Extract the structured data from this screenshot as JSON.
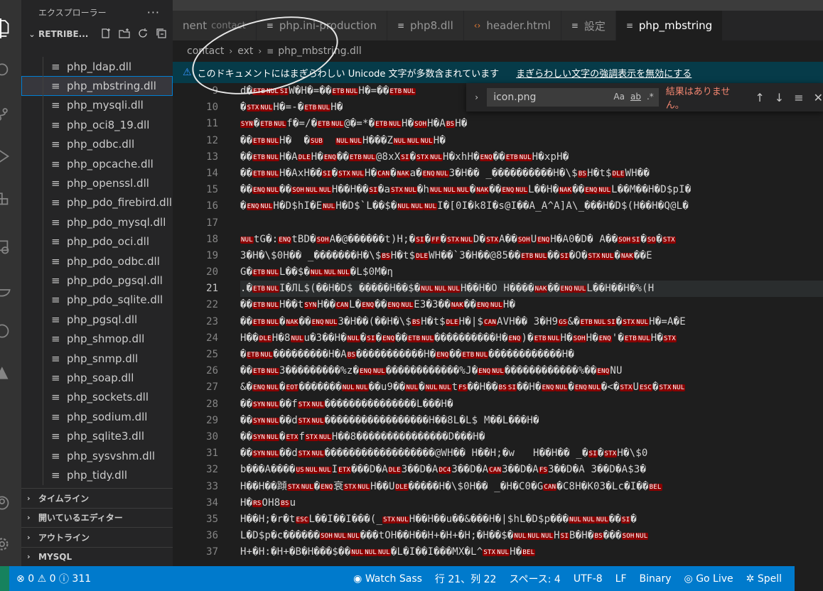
{
  "explorer": {
    "title": "エクスプローラー",
    "more": "···",
    "folder": "RETRIBE...",
    "files": [
      "php_ldap.dll",
      "php_mbstring.dll",
      "php_mysqli.dll",
      "php_oci8_19.dll",
      "php_odbc.dll",
      "php_opcache.dll",
      "php_openssl.dll",
      "php_pdo_firebird.dll",
      "php_pdo_mysql.dll",
      "php_pdo_oci.dll",
      "php_pdo_odbc.dll",
      "php_pdo_pgsql.dll",
      "php_pdo_sqlite.dll",
      "php_pgsql.dll",
      "php_shmop.dll",
      "php_snmp.dll",
      "php_soap.dll",
      "php_sockets.dll",
      "php_sodium.dll",
      "php_sqlite3.dll",
      "php_sysvshm.dll",
      "php_tidy.dll"
    ],
    "selected_index": 1,
    "panels": [
      "タイムライン",
      "開いているエディター",
      "アウトライン",
      "MYSQL"
    ]
  },
  "tabs": [
    {
      "label": "nent",
      "desc": "contact",
      "icon": "file-icon"
    },
    {
      "label": "php.ini-production",
      "icon": "file-icon"
    },
    {
      "label": "php8.dll",
      "icon": "file-icon"
    },
    {
      "label": "header.html",
      "icon": "html-icon"
    },
    {
      "label": "設定",
      "icon": "file-icon"
    },
    {
      "label": "php_mbstring",
      "icon": "file-icon",
      "active": true
    }
  ],
  "breadcrumb": [
    "contact",
    "ext",
    "php_mbstring.dll"
  ],
  "banner": {
    "message": "このドキュメントにはまぎらわしい Unicode 文字が多数含まれています",
    "link": "まぎらわしい文字の強調表示を無効にする"
  },
  "find": {
    "query": "icon.png",
    "opt_case": "Aa",
    "opt_word": "ab",
    "opt_regex": ".*",
    "result": "結果はありません。"
  },
  "editor": {
    "current_line": 21,
    "lines": [
      {
        "n": 9,
        "text": "d�ETBNULSIW�H�=��ETBNULH�=��ETBNUL"
      },
      {
        "n": 10,
        "text": "�STXNULH�=-�ETBNULH�"
      },
      {
        "n": 11,
        "text": "SYN�ETBNULf�=/�ETBNUL@�=*�ETBNULH�SOHH�ABSH�"
      },
      {
        "n": 12,
        "text": "��ETBNULH�  �SUB  NULNULH���ZNULNULNULH�"
      },
      {
        "n": 13,
        "text": "��ETBNULH�ADLEH�ENQ��ETBNUL@8xXSI�STXNULH�xhH�ENQ��ETBNULH�xpH�"
      },
      {
        "n": 14,
        "text": "��ETBNULH�AxH��SI�STXNULH�CAN�NAKa�ENQNUL3�H�� _����������H�\\$BSH�t$DLEWH��"
      },
      {
        "n": 15,
        "text": "��ENQNUL��SOHNULNULH��H��SI�aSTXNUL�hNULNULNUL�NAK��ENQNULL��H�NAK��ENQNULL��M��H�D$pI�"
      },
      {
        "n": 16,
        "text": "�ENQNULH�D$hI�ENULH�D$`L��$�NULNULNULI�[0I�k8I�s@I��A_A^A]A\\_���H�D$(H��H�Q@L�"
      },
      {
        "n": 17,
        "text": ""
      },
      {
        "n": 18,
        "text": "NULtG�:ENQtBD�SOHA�@������t)H;�SI�FF�STXNULD�STXA��SOHUENQH�A0�D� A��SOHSI�SO�STX"
      },
      {
        "n": 19,
        "text": "3�H�\\$0H�� _�������H�\\$BSH�t$DLEWH��`3�H��@85��ETBNUL��SI�O�STXNUL�NAK��E"
      },
      {
        "n": 20,
        "text": "G�ETBNULL��$�NULNULNUL�L$0M�η"
      },
      {
        "n": 21,
        "text": ".�ETBNULI�ЛL$(��H�D$ �����H��$�NULNULNULH��H�O H����NAK��ENQNULL��H��H�%(H"
      },
      {
        "n": 22,
        "text": "��ETBNULH��tSYNH��CANL�ENQ��ENQNULE3�3��NAK��ENQNULH�"
      },
      {
        "n": 23,
        "text": "��ETBNUL�NAK��ENQNUL3�H��(��H�\\$BSH�t$DLEH�|$CANAVH�� 3�H9GS&�ETBNULSI�STXNULH�=A�E"
      },
      {
        "n": 24,
        "text": "H��DLEH�8NULu�3��H�NUL�SI�ENQ��ETBNUL����������H�ENQ)�ETBNULH�SOHH�ENQ'�ETBNULH�STX"
      },
      {
        "n": 25,
        "text": "�ETBNUL���������H�ABS�����������H�ENQ��ETBNUL������������H�"
      },
      {
        "n": 26,
        "text": "��ETBNUL3���������%z�ENQNUL������������%J�ENQNUL������������%��ENQNU"
      },
      {
        "n": 27,
        "text": "&�ENQNUL�EOT�������NULNUL��u9��NUL�NULNULtFS��H��BSSI��H�ENQNUL�ENQNUL�<�STXUESC�STXNUL"
      },
      {
        "n": 28,
        "text": "��SYNNUL��fSTXNUL���������������L���H�"
      },
      {
        "n": 29,
        "text": "��SYNNUL��dSTXNUL�����������������H��8L�L$ M��L���H�"
      },
      {
        "n": 30,
        "text": "��SYNNUL�ETXfSTXNULH��8���������������D���H�"
      },
      {
        "n": 31,
        "text": "��SYNNUL��dSTXNUL������������������@WH�� H��H;�w   H��H�� _�SI�STXH�\\$0"
      },
      {
        "n": 32,
        "text": "b���A����USNULNULIETX���D�ADLE3��D�ADC43��D�ACAN3��D�AFS3��D�A 3��D�A$3�"
      },
      {
        "n": 33,
        "text": "H��H��蹞STXNUL�ENQ衰STXNULH��UDLE�����H�\\$0H�� _�H�C0�GCAN�C8H�K03�Lc�I��BEL"
      },
      {
        "n": 34,
        "text": "H�RSOH8BSu"
      },
      {
        "n": 35,
        "text": "H��H;�r�tESCL��I��I���(_STXNULH��H��u��&���H�|$hL�D$p���NULNULNUL��SI�"
      },
      {
        "n": 36,
        "text": "L�D$p�c������SOHNULNUL���tOH��H��H+�H+�H;�H��$�NULNULNULHSIB�H�BS���SOHNUL"
      },
      {
        "n": 37,
        "text": "H+�H:�H+�B�H���$��NULNULNUL�L�I��I���MX�L^STXNULH�BEL"
      }
    ]
  },
  "status": {
    "errors": "0",
    "warnings": "0",
    "info": "311",
    "watch_sass": "Watch Sass",
    "position": "行 21、列 22",
    "spaces": "スペース: 4",
    "encoding": "UTF-8",
    "eol": "LF",
    "language": "Binary",
    "go_live": "Go Live",
    "spell": "Spell"
  },
  "colors": {
    "accent": "#007acc",
    "control_char_bg": "#8b0000",
    "banner_bg": "#063b49",
    "find_no_result": "#f48771"
  }
}
